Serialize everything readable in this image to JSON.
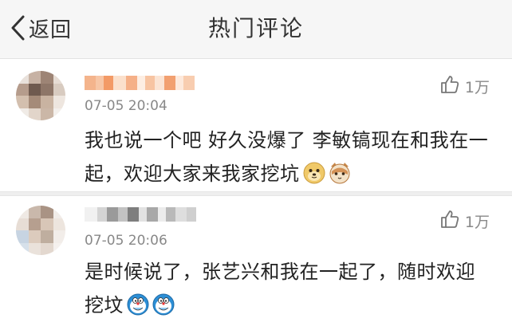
{
  "nav": {
    "back_label": "返回",
    "title": "热门评论"
  },
  "comments": [
    {
      "timestamp": "07-05 20:04",
      "likes": "1万",
      "text": "我也说一个吧 好久没爆了 李敏镐现在和我在一起，欢迎大家来我家挖坑",
      "emojis": [
        "doge-emoji",
        "cat-emoji"
      ]
    },
    {
      "timestamp": "07-05 20:06",
      "likes": "1万",
      "text": "是时候说了，张艺兴和我在一起了，随时欢迎挖坟",
      "emojis": [
        "doraemon-emoji",
        "doraemon-emoji"
      ]
    }
  ],
  "icons": {
    "back": "chevron-left-icon",
    "like": "thumbs-up-icon"
  },
  "colors": {
    "nav_bg": "#f6f6f6",
    "meta_text": "#888888",
    "body_text": "#222222"
  }
}
